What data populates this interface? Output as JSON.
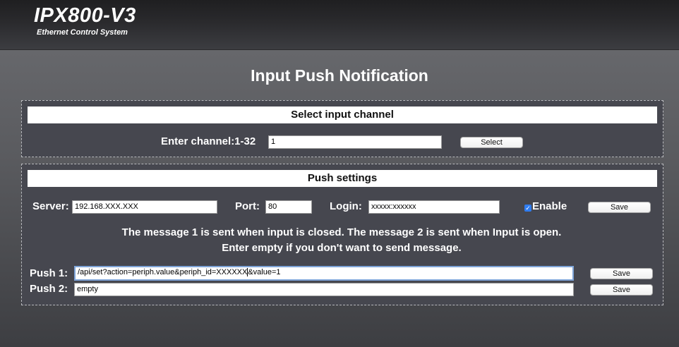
{
  "header": {
    "logo": "IPX800-V3",
    "subtitle": "Ethernet Control System"
  },
  "page_title": "Input Push Notification",
  "select_section": {
    "title": "Select input channel",
    "channel_label": "Enter channel:1-32",
    "channel_value": "1",
    "select_button": "Select"
  },
  "push_section": {
    "title": "Push settings",
    "server_label": "Server:",
    "server_value": "192.168.XXX.XXX",
    "port_label": "Port:",
    "port_value": "80",
    "login_label": "Login:",
    "login_value": "xxxxx:xxxxxx",
    "enable_label": "Enable",
    "enable_checked": true,
    "save_settings_button": "Save",
    "message_line_1": "The message 1 is sent when input is closed. The message 2 is sent when Input is open.",
    "message_line_2": "Enter empty if you don't want to send message.",
    "push1_label": "Push 1:",
    "push1_value_before_caret": "/api/set?action=periph.value&periph_id=XXXXXX",
    "push1_value_after_caret": "&value=1",
    "push1_save_button": "Save",
    "push2_label": "Push 2:",
    "push2_value": "empty",
    "push2_save_button": "Save"
  },
  "colors": {
    "header_bg": "#2a2a2d",
    "page_bg": "#5a5b5f",
    "panel_bg": "#46474f",
    "checkbox_accent": "#2f7cf0",
    "focus_ring": "#7ea4d8"
  }
}
